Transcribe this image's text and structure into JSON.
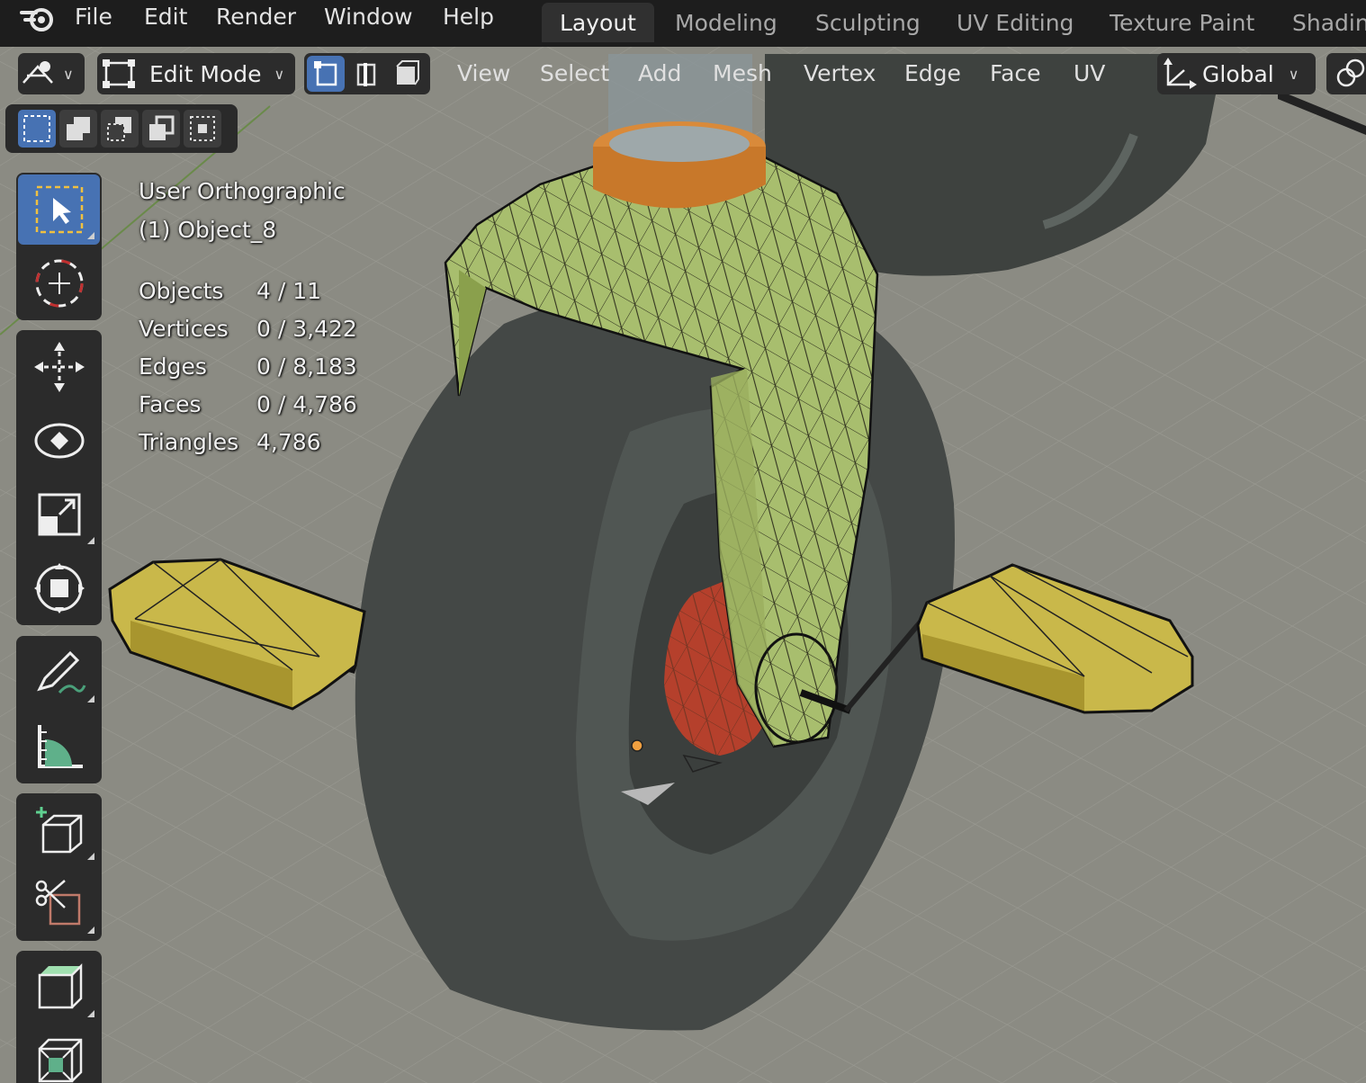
{
  "app": "Blender",
  "menu": {
    "items": [
      "File",
      "Edit",
      "Render",
      "Window",
      "Help"
    ]
  },
  "workspaces": {
    "tabs": [
      "Layout",
      "Modeling",
      "Sculpting",
      "UV Editing",
      "Texture Paint",
      "Shadin"
    ],
    "active": "Layout"
  },
  "header": {
    "mode": "Edit Mode",
    "menus": [
      "View",
      "Select",
      "Add",
      "Mesh",
      "Vertex",
      "Edge",
      "Face",
      "UV"
    ],
    "orientation": "Global"
  },
  "overlay": {
    "view_name": "User Orthographic",
    "object_name": "(1) Object_8",
    "stats": [
      {
        "label": "Objects",
        "value": "4 / 11"
      },
      {
        "label": "Vertices",
        "value": "0 / 3,422"
      },
      {
        "label": "Edges",
        "value": "0 / 8,183"
      },
      {
        "label": "Faces",
        "value": "0 / 4,786"
      },
      {
        "label": "Triangles",
        "value": "4,786"
      }
    ]
  },
  "toolbar": {
    "tools": [
      "select-box",
      "cursor",
      "move",
      "rotate",
      "scale",
      "transform",
      "annotate",
      "measure",
      "add-cube",
      "knife",
      "extrude",
      "inset"
    ]
  },
  "colors": {
    "accent": "#4772b3",
    "mesh_green": "#a8be6e",
    "pedal_yellow": "#c9b84a",
    "hub_red": "#b5402c",
    "tire_gray": "#4b4f4c",
    "orange_ring": "#d98a3a"
  }
}
